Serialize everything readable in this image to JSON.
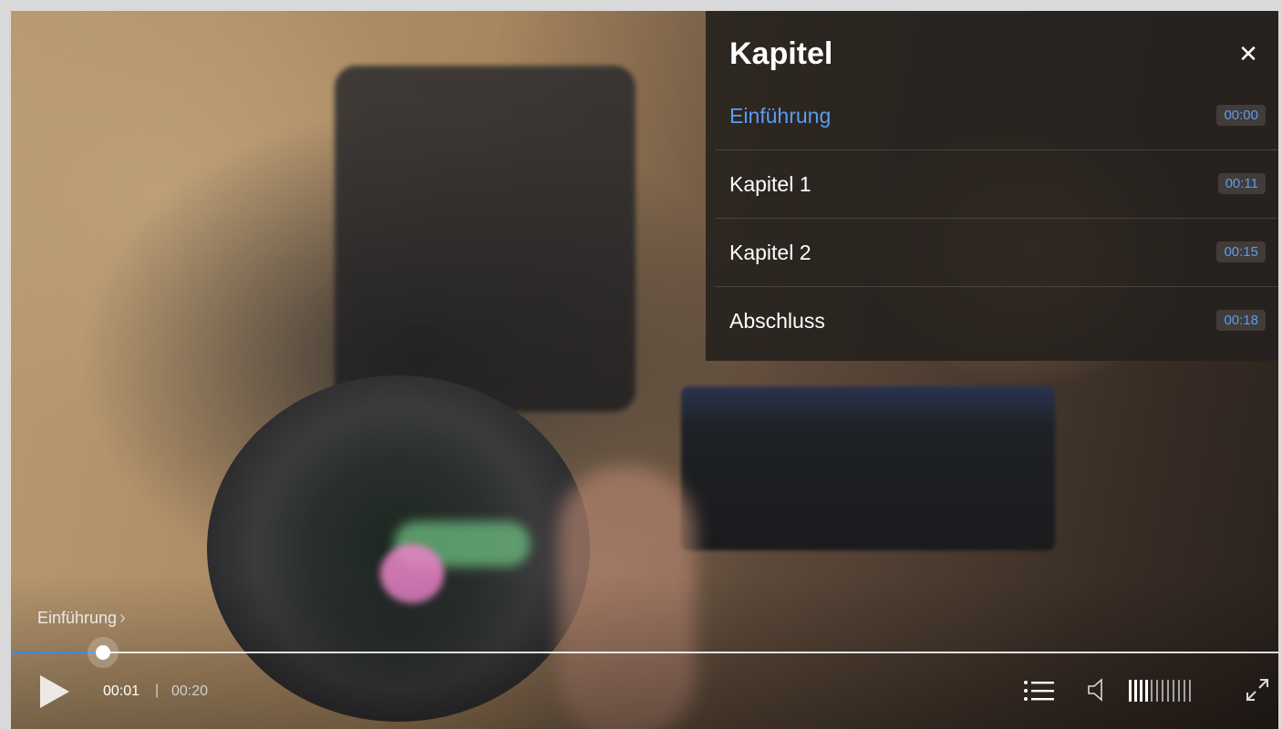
{
  "chapters_panel": {
    "title": "Kapitel",
    "close_icon": "close-icon",
    "items": [
      {
        "label": "Einführung",
        "time": "00:00",
        "active": true
      },
      {
        "label": "Kapitel 1",
        "time": "00:11",
        "active": false
      },
      {
        "label": "Kapitel 2",
        "time": "00:15",
        "active": false
      },
      {
        "label": "Abschluss",
        "time": "00:18",
        "active": false
      }
    ]
  },
  "controls": {
    "current_chapter": "Einführung",
    "current_time": "00:01",
    "separator": "|",
    "duration": "00:20",
    "progress_fraction": 0.073,
    "volume_fraction": 0.3,
    "icons": {
      "play": "play-icon",
      "chapters": "chapters-list-icon",
      "volume": "volume-icon",
      "fullscreen": "fullscreen-icon",
      "chevron": "chevron-right-icon"
    }
  },
  "colors": {
    "accent": "#5b9cf0",
    "progress": "#3f86e0",
    "panel_bg": "#26211e"
  }
}
